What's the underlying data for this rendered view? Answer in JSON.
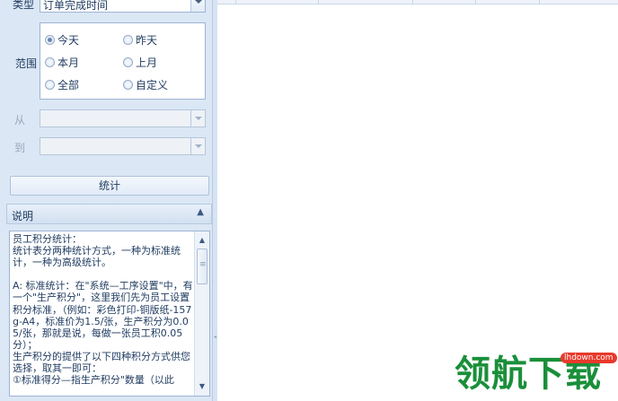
{
  "query": {
    "type_label": "类型",
    "type_value": "订单完成时间",
    "range_label": "范围",
    "range_options": [
      {
        "label": "今天",
        "checked": true
      },
      {
        "label": "昨天",
        "checked": false
      },
      {
        "label": "本月",
        "checked": false
      },
      {
        "label": "上月",
        "checked": false
      },
      {
        "label": "全部",
        "checked": false
      },
      {
        "label": "自定义",
        "checked": false
      }
    ],
    "from_label": "从",
    "to_label": "到",
    "from_value": "",
    "to_value": "",
    "stat_button": "统计"
  },
  "description": {
    "header": "说明",
    "text": "员工积分统计：\n统计表分两种统计方式，一种为标准统计，一种为高级统计。\n\nA: 标准统计：在\"系统—工序设置\"中，有一个\"生产积分\"，这里我们先为员工设置积分标准，（例如：彩色打印-铜版纸-157g-A4，标准价为1.5/张，生产积分为0.05/张，那就是说，每做一张员工积0.05分）；\n生产积分的提供了以下四种积分方式供您选择，取其一即可：\n①标准得分—指生产积分\"数量（以此"
  },
  "watermark": {
    "text": "领航下载",
    "badge": "lhdown.com"
  },
  "colors": {
    "panel_bg": "#dbe7f5",
    "text": "#1e3a5f",
    "watermark": "#1a8f3a",
    "watermark_badge": "#e8392c"
  }
}
